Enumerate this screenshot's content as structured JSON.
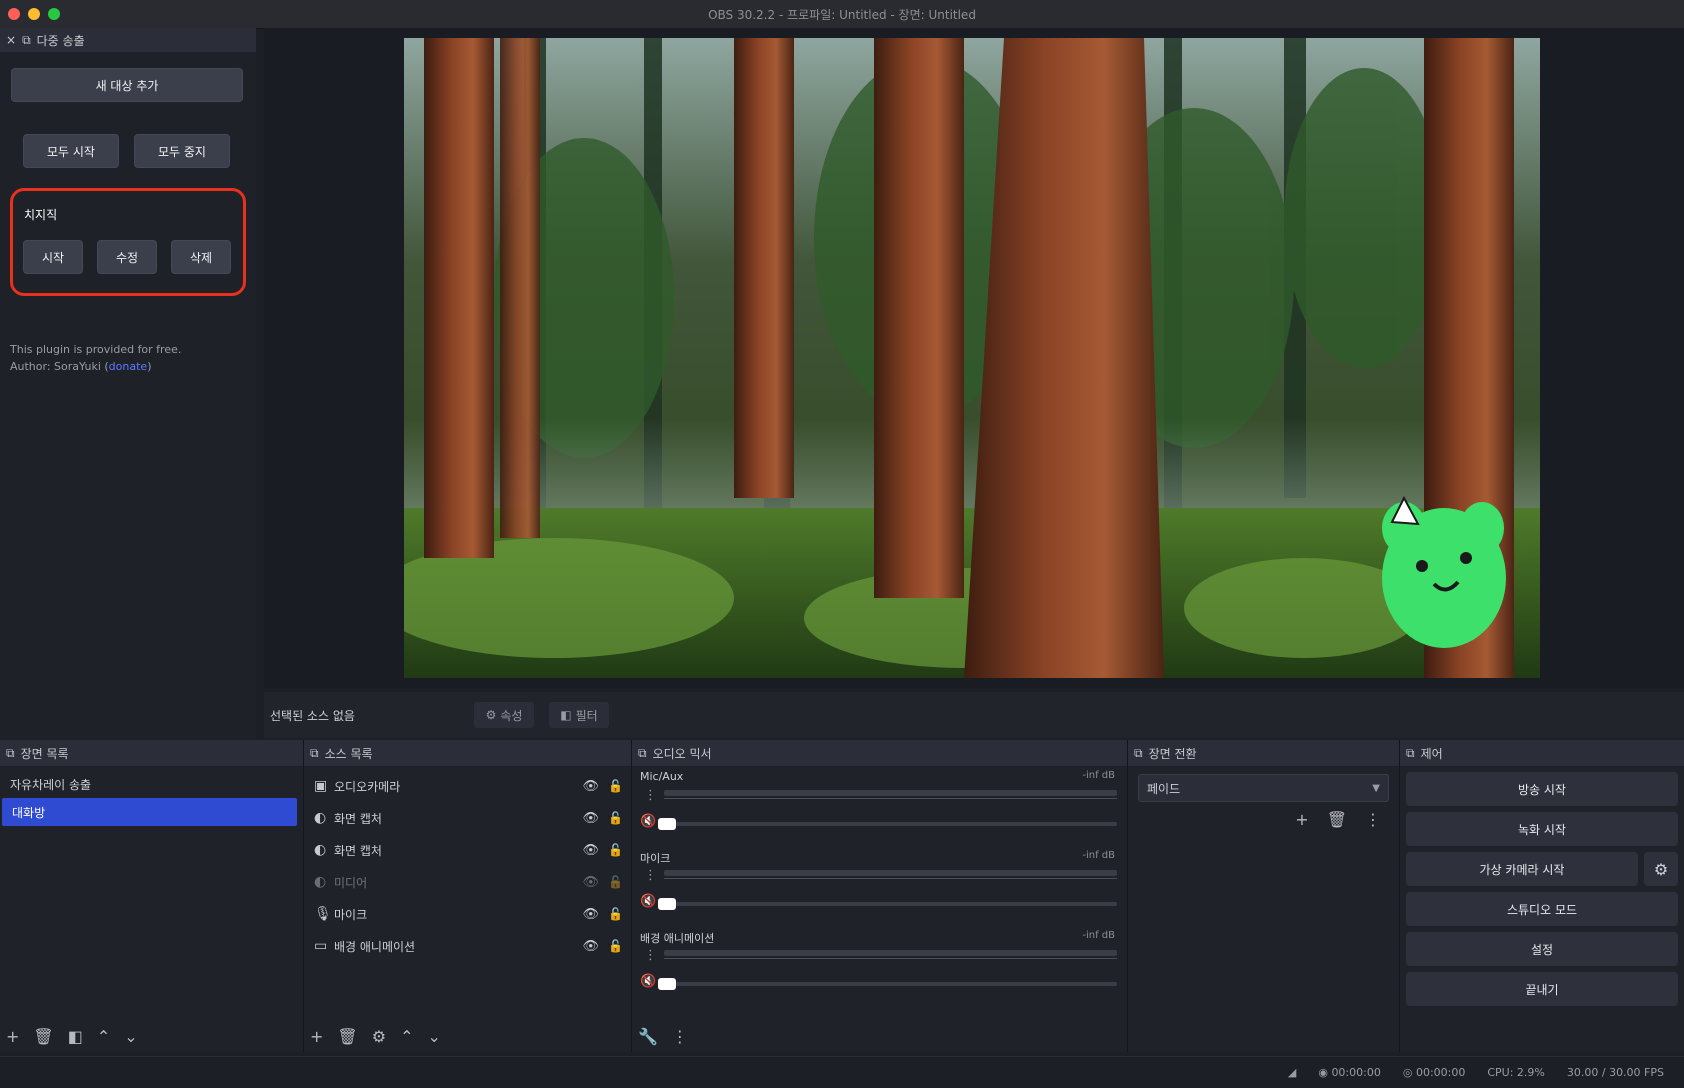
{
  "window": {
    "title": "OBS 30.2.2 - 프로파일: Untitled - 장면: Untitled"
  },
  "left_dock": {
    "title": "다중 송출",
    "add_target": "새 대상 추가",
    "start_all": "모두 시작",
    "stop_all": "모두 중지",
    "target": {
      "name": "치지직",
      "start": "시작",
      "edit": "수정",
      "delete": "삭제"
    },
    "note_line1": "This plugin is provided for free.",
    "note_line2_prefix": "Author: SoraYuki (",
    "note_link": "donate",
    "note_line2_suffix": ")"
  },
  "preview_bar": {
    "label": "선택된 소스 없음",
    "props": "속성",
    "filters": "필터"
  },
  "scenes": {
    "title": "장면 목록",
    "items": [
      {
        "label": "자유차레이 송출"
      },
      {
        "label": "대화방",
        "selected": true
      }
    ]
  },
  "sources": {
    "title": "소스 목록",
    "items": [
      {
        "label": "오디오카메라",
        "icon": "monitor-icon"
      },
      {
        "label": "화면 캡처",
        "icon": "color-icon"
      },
      {
        "label": "화면 캡처",
        "icon": "color-icon"
      },
      {
        "label": "미디어",
        "icon": "color-icon",
        "hidden": true
      },
      {
        "label": "마이크",
        "icon": "mic-icon"
      },
      {
        "label": "배경 애니메이션",
        "icon": "display-icon"
      }
    ]
  },
  "mixer": {
    "title": "오디오 믹서",
    "channels": [
      {
        "name": "Mic/Aux",
        "db": "-inf dB",
        "level": 0.0
      },
      {
        "name": "마이크",
        "db": "-inf dB",
        "level": 0.0
      },
      {
        "name": "배경 애니메이션",
        "db": "-inf dB",
        "level": 0.0
      }
    ]
  },
  "transitions": {
    "title": "장면 전환",
    "selected": "페이드"
  },
  "controls": {
    "title": "제어",
    "buttons": [
      "방송 시작",
      "녹화 시작",
      "가상 카메라 시작",
      "스튜디오 모드",
      "설정",
      "끝내기"
    ]
  },
  "status": {
    "live": "00:00:00",
    "rec": "00:00:00",
    "cpu": "CPU: 2.9%",
    "fps": "30.00 / 30.00 FPS"
  },
  "colors": {
    "highlight": "#e8311c",
    "selected_row": "#2f4bd1",
    "accent_link": "#5b7cff"
  }
}
